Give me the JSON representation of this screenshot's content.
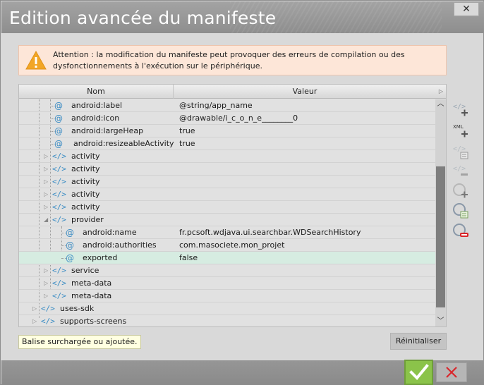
{
  "window": {
    "title": "Edition avancée du manifeste",
    "close_glyph": "✕"
  },
  "warning": {
    "icon": "warning-triangle-icon",
    "text": "Attention : la modification du manifeste peut provoquer des erreurs de compilation ou des dysfonctionnements à l'exécution sur le périphérique."
  },
  "tree": {
    "columns": [
      "Nom",
      "Valeur"
    ],
    "rows": [
      {
        "kind": "attr",
        "name": "android:label",
        "value": "@string/app_name"
      },
      {
        "kind": "attr",
        "name": "android:icon",
        "value": "@drawable/i_c_o_n_e________0"
      },
      {
        "kind": "attr",
        "name": "android:largeHeap",
        "value": "true"
      },
      {
        "kind": "attr",
        "name": "android:resizeableActivity",
        "value": "true"
      },
      {
        "kind": "tag",
        "name": "activity",
        "value": ""
      },
      {
        "kind": "tag",
        "name": "activity",
        "value": ""
      },
      {
        "kind": "tag",
        "name": "activity",
        "value": ""
      },
      {
        "kind": "tag",
        "name": "activity",
        "value": ""
      },
      {
        "kind": "tag",
        "name": "activity",
        "value": ""
      },
      {
        "kind": "tag",
        "name": "provider",
        "value": ""
      },
      {
        "kind": "attr",
        "name": "android:name",
        "value": "fr.pcsoft.wdjava.ui.searchbar.WDSearchHistory"
      },
      {
        "kind": "attr",
        "name": "android:authorities",
        "value": "com.masociete.mon_projet"
      },
      {
        "kind": "attr",
        "name": "exported",
        "value": "false"
      },
      {
        "kind": "tag",
        "name": "service",
        "value": ""
      },
      {
        "kind": "tag",
        "name": "meta-data",
        "value": ""
      },
      {
        "kind": "tag",
        "name": "meta-data",
        "value": ""
      },
      {
        "kind": "tag",
        "name": "uses-sdk",
        "value": ""
      },
      {
        "kind": "tag",
        "name": "supports-screens",
        "value": ""
      }
    ],
    "selected_row": "exported"
  },
  "toolbar": {
    "xml_label": "XML",
    "buttons": [
      "add-tag-icon",
      "add-xml-icon",
      "edit-tag-icon",
      "remove-tag-icon",
      "add-attribute-icon",
      "edit-attribute-icon",
      "remove-attribute-icon"
    ]
  },
  "bottom": {
    "tooltip": "Balise surchargée ou ajoutée.",
    "reset_label": "Réinitialiser"
  },
  "colors": {
    "accent_green": "#8bc34a",
    "cancel_red": "#d9262b",
    "tag_blue": "#3a8cc4",
    "selected_row": "#d6ece1",
    "warning_bg": "#fde6d8",
    "warning_icon": "#f2a626"
  }
}
